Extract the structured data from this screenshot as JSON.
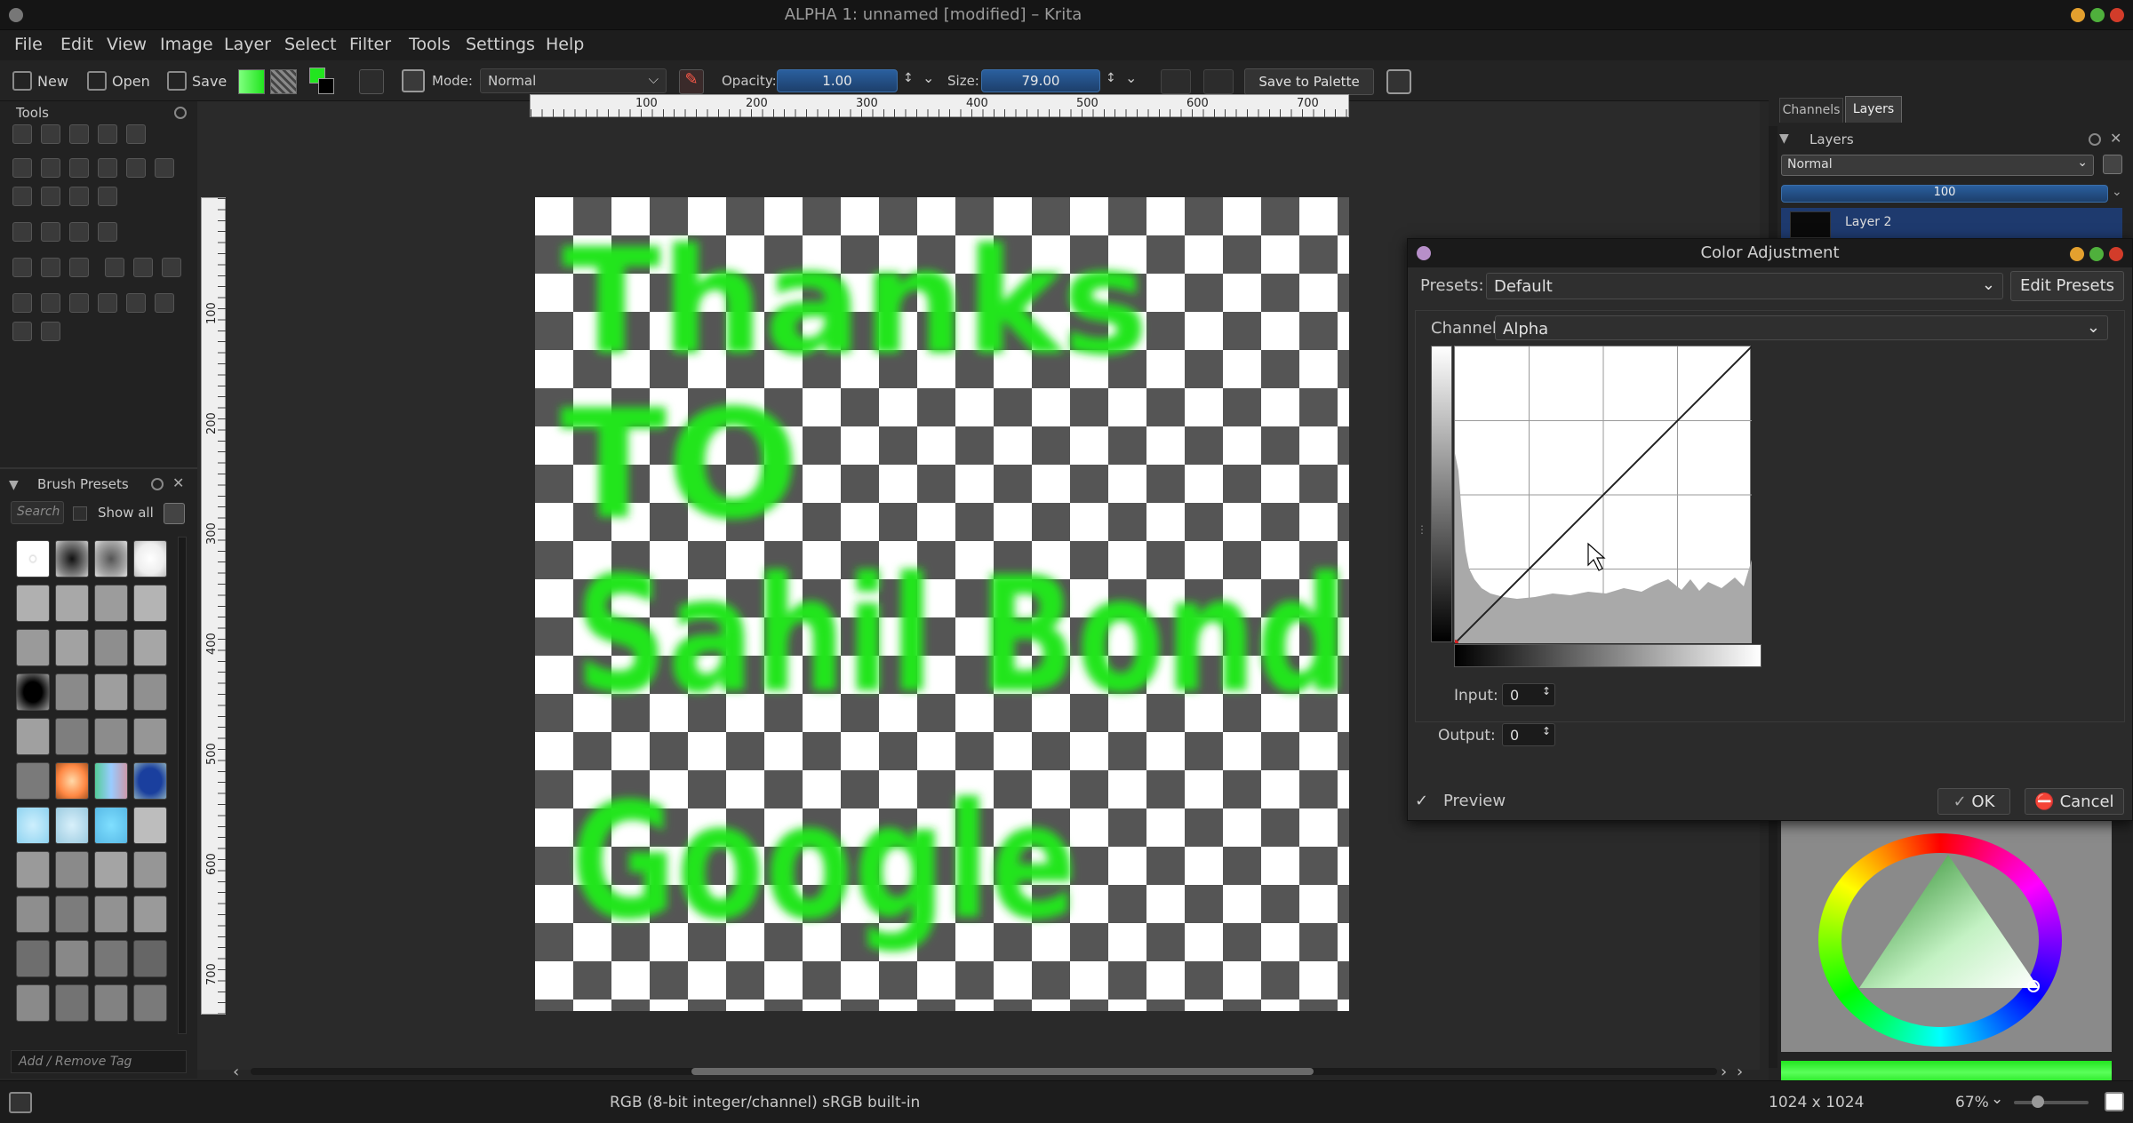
{
  "window": {
    "title": "ALPHA 1: unnamed [modified] – Krita"
  },
  "menu": [
    "File",
    "Edit",
    "View",
    "Image",
    "Layer",
    "Select",
    "Filter",
    "Tools",
    "Settings",
    "Help"
  ],
  "toolbar": {
    "new": "New",
    "open": "Open",
    "save": "Save",
    "mode_label": "Mode:",
    "mode_value": "Normal",
    "opacity_label": "Opacity:",
    "opacity_value": "1.00",
    "size_label": "Size:",
    "size_value": "79.00",
    "save_palette": "Save to Palette"
  },
  "tools_panel": {
    "title": "Tools"
  },
  "brush_presets": {
    "title": "Brush Presets",
    "search": "Search",
    "show_all": "Show all",
    "tag_placeholder": "Add / Remove Tag"
  },
  "rulers": {
    "h_ticks": [
      "100",
      "200",
      "300",
      "400",
      "500",
      "600",
      "700"
    ],
    "v_ticks": [
      "100",
      "200",
      "300",
      "400",
      "500",
      "600",
      "700"
    ]
  },
  "canvas": {
    "lines": [
      "Thanks",
      "TO",
      "Sahil Bond",
      "Google"
    ],
    "stroke_color": "#22e51f"
  },
  "layers_panel": {
    "tabs": [
      "Channels",
      "Layers"
    ],
    "title": "Layers",
    "blend_mode": "Normal",
    "opacity": "100",
    "layer_name": "Layer 2"
  },
  "color_adjustment": {
    "title": "Color Adjustment",
    "presets_label": "Presets:",
    "presets_value": "Default",
    "edit_presets": "Edit Presets",
    "channel_label": "Channel:",
    "channel_value": "Alpha",
    "input_label": "Input:",
    "input_value": "0",
    "output_label": "Output:",
    "output_value": "0",
    "preview_label": "Preview",
    "ok": "OK",
    "cancel": "Cancel"
  },
  "statusbar": {
    "color_profile": "RGB (8-bit integer/channel)  sRGB built-in",
    "dimensions": "1024 x 1024",
    "zoom": "67%"
  }
}
